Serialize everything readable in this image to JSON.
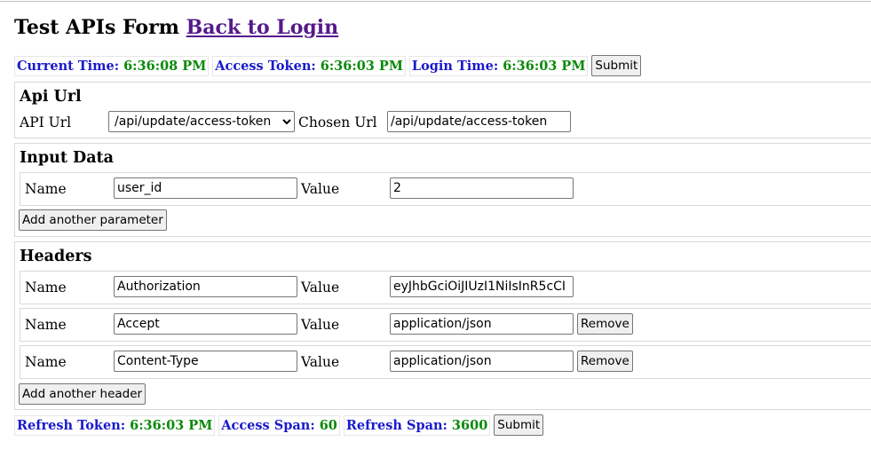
{
  "page": {
    "title": "Test APIs Form",
    "back_link": "Back to Login"
  },
  "top_status": {
    "current_time_label": "Current Time:",
    "current_time": "6:36:08 PM",
    "access_token_label": "Access Token:",
    "access_token": "6:36:03 PM",
    "login_time_label": "Login Time:",
    "login_time": "6:36:03 PM",
    "submit_label": "Submit"
  },
  "api_url": {
    "heading": "Api Url",
    "label": "API Url",
    "selected": "/api/update/access-token",
    "chosen_label": "Chosen Url",
    "chosen_value": "/api/update/access-token"
  },
  "input_data": {
    "heading": "Input Data",
    "params": [
      {
        "name_label": "Name",
        "name": "user_id",
        "value_label": "Value",
        "value": "2"
      }
    ],
    "add_label": "Add another parameter"
  },
  "headers": {
    "heading": "Headers",
    "items": [
      {
        "name_label": "Name",
        "name": "Authorization",
        "value_label": "Value",
        "value": "eyJhbGciOiJIUzI1NiIsInR5cCI"
      },
      {
        "name_label": "Name",
        "name": "Accept",
        "value_label": "Value",
        "value": "application/json",
        "remove_label": "Remove"
      },
      {
        "name_label": "Name",
        "name": "Content-Type",
        "value_label": "Value",
        "value": "application/json",
        "remove_label": "Remove"
      }
    ],
    "add_label": "Add another header"
  },
  "bottom_status": {
    "refresh_token_label": "Refresh Token:",
    "refresh_token": "6:36:03 PM",
    "access_span_label": "Access Span:",
    "access_span": "60",
    "refresh_span_label": "Refresh Span:",
    "refresh_span": "3600",
    "submit_label": "Submit"
  },
  "colors": {
    "label_blue": "#1a1acc",
    "value_green": "#0a8a0a",
    "link_visited": "#551a8b"
  }
}
